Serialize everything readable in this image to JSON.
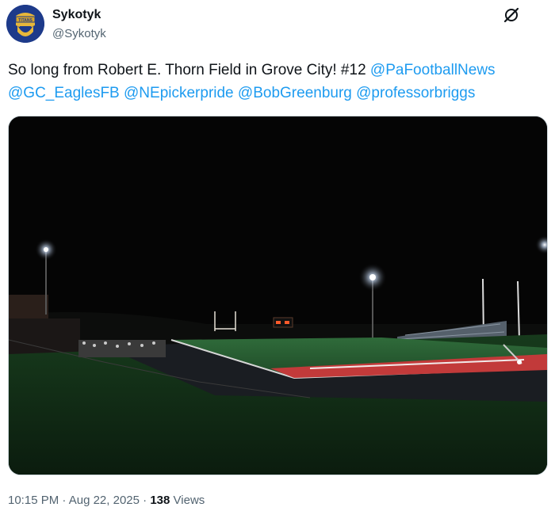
{
  "author": {
    "name": "Sykotyk",
    "handle": "@Sykotyk",
    "avatar_text": "TITANS"
  },
  "tweet": {
    "text": "So long from Robert E. Thorn Field in Grove City! #12",
    "mentions": [
      "@PaFootballNews",
      "@GC_EaglesFB",
      "@NEpickerpride",
      "@BobGreenburg",
      "@professorbriggs"
    ]
  },
  "meta": {
    "time": "10:15 PM",
    "sep1": "·",
    "date": "Aug 22, 2025",
    "sep2": "·",
    "views_count": "138",
    "views_label": "Views"
  },
  "colors": {
    "link": "#1d9bf0",
    "muted": "#536471",
    "text": "#0f1419"
  },
  "icons": [
    "grok-icon"
  ]
}
